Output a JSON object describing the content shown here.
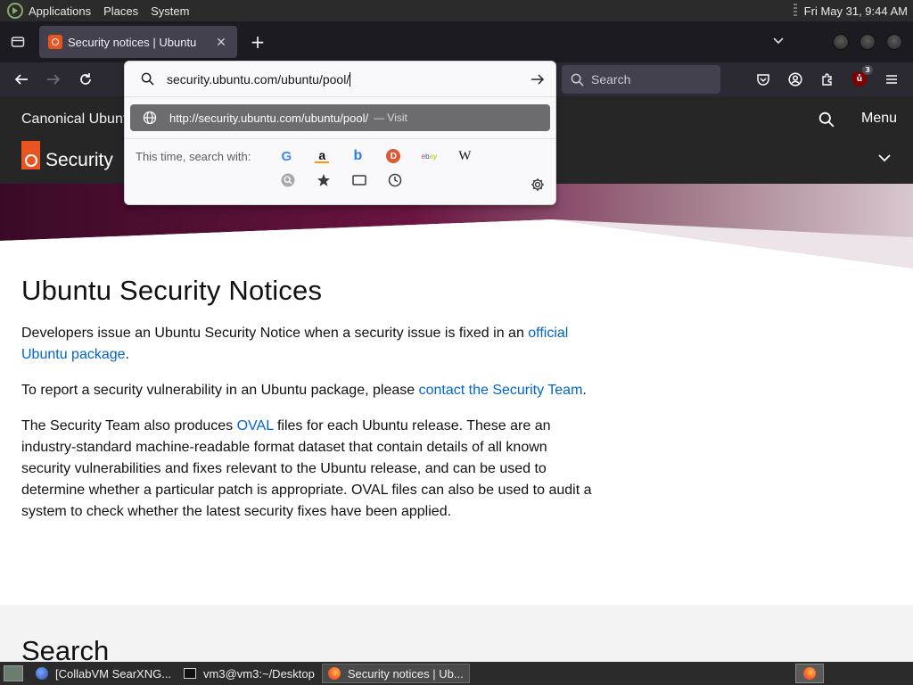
{
  "system_panel": {
    "menus": [
      "Applications",
      "Places",
      "System"
    ],
    "clock": "Fri May 31,  9:44 AM"
  },
  "browser": {
    "tab": {
      "title": "Security notices | Ubuntu"
    },
    "search_placeholder": "Search",
    "ublock_count": "3"
  },
  "urlbar": {
    "typed": "security.ubuntu.com/ubuntu/pool/",
    "suggestion_url": "http://security.ubuntu.com/ubuntu/pool/",
    "suggestion_action": "— Visit",
    "search_with_label": "This time, search with:",
    "engines": [
      "Google",
      "Amazon",
      "Bing",
      "DuckDuckGo",
      "eBay",
      "Wikipedia"
    ],
    "source_buttons": [
      "Search history",
      "Bookmarks",
      "Tabs",
      "History"
    ]
  },
  "site": {
    "brand": "Canonical Ubuntu",
    "section": "Security",
    "menu_label": "Menu",
    "heading": "Ubuntu Security Notices",
    "p1_text": "Developers issue an Ubuntu Security Notice when a security issue is fixed in an ",
    "p1_link": "official Ubuntu package",
    "p1_end": ".",
    "p2_text": "To report a security vulnerability in an Ubuntu package, please ",
    "p2_link": "contact the Security Team",
    "p2_end": ".",
    "p3_text": "The Security Team also produces ",
    "p3_link": "OVAL",
    "p3_rest": " files for each Ubuntu release. These are an industry-standard machine-readable format dataset that contain details of all known security vulnerabilities and fixes relevant to the Ubuntu release, and can be used to determine whether a particular patch is appropriate. OVAL files can also be used to audit a system to check whether the latest security fixes have been applied.",
    "search_heading": "Search"
  },
  "taskbar": {
    "tasks": [
      "[CollabVM SearXNG...",
      "vm3@vm3:~/Desktop",
      "Security notices | Ub..."
    ]
  },
  "colors": {
    "ubuntu_orange": "#e95420",
    "link": "#0066cc",
    "hero_dark": "#5c0f3c"
  }
}
